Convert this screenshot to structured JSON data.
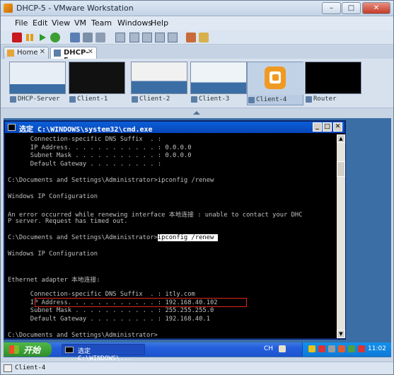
{
  "window": {
    "title": "DHCP-5 - VMware Workstation"
  },
  "menu": [
    "File",
    "Edit",
    "View",
    "VM",
    "Team",
    "Windows",
    "Help"
  ],
  "tabs": [
    {
      "label": "Home"
    },
    {
      "label": "DHCP-5"
    }
  ],
  "thumbnails": [
    "DHCP-Server",
    "Client-1",
    "Client-2",
    "Client-3",
    "Client-4",
    "Router"
  ],
  "cmd": {
    "title": "选定 C:\\WINDOWS\\system32\\cmd.exe",
    "lines": [
      "      Connection-specific DNS Suffix  . :",
      "      IP Address. . . . . . . . . . . . : 0.0.0.0",
      "      Subnet Mask . . . . . . . . . . . : 0.0.0.0",
      "      Default Gateway . . . . . . . . . :",
      "",
      "C:\\Documents and Settings\\Administrator>ipconfig /renew",
      "",
      "Windows IP Configuration",
      "",
      "An error occurred while renewing interface 本地连接 : unable to contact your DHC",
      "P server. Request has timed out.",
      "",
      "C:\\Documents and Settings\\Administrator>",
      "",
      "Windows IP Configuration",
      "",
      "",
      "Ethernet adapter 本地连接:",
      "",
      "      Connection-specific DNS Suffix  . : itly.com",
      "      IP Address. . . . . . . . . . . . : 192.168.40.102",
      "      Subnet Mask . . . . . . . . . . . : 255.255.255.0",
      "      Default Gateway . . . . . . . . . : 192.168.40.1",
      "",
      "C:\\Documents and Settings\\Administrator>"
    ],
    "selected_command": "ipconfig /renew "
  },
  "taskbar": {
    "start_label": "开始",
    "task_label": "选定 C:\\WINDOWS\\...",
    "lang": "CH",
    "clock": "11:02"
  },
  "status": {
    "text": "Client-4"
  }
}
